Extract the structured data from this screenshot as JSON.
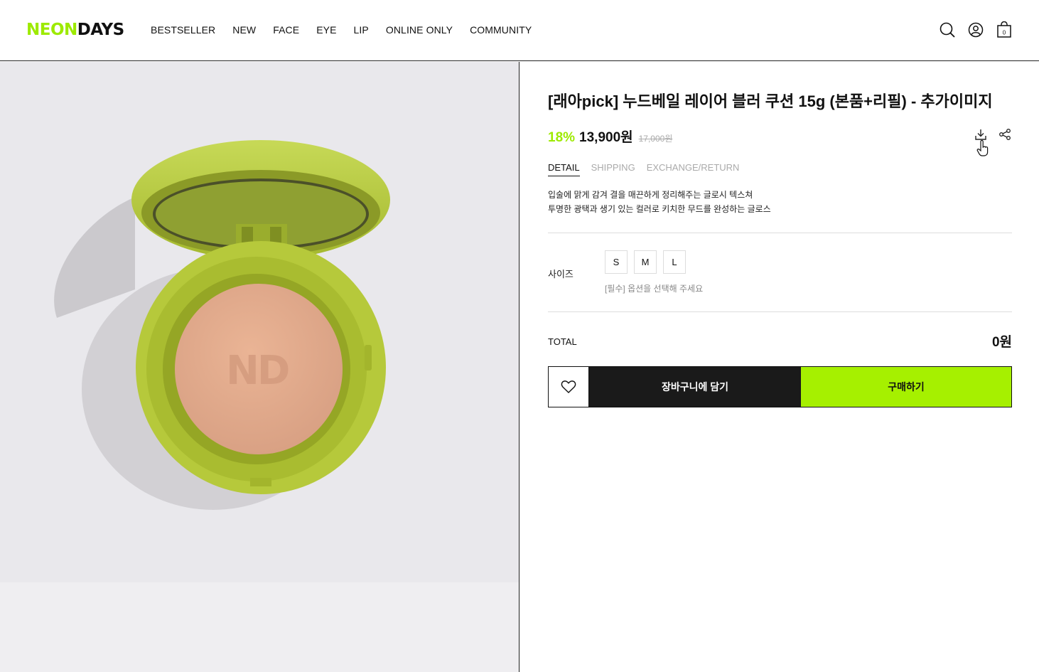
{
  "header": {
    "logo_neon": "NEON",
    "logo_days": "DAYS",
    "nav": [
      "BESTSELLER",
      "NEW",
      "FACE",
      "EYE",
      "LIP",
      "ONLINE ONLY",
      "COMMUNITY"
    ],
    "cart_count": "0",
    "icons": [
      "search-icon",
      "user-icon",
      "bag-icon"
    ]
  },
  "product": {
    "title": "[래아pick] 누드베일 레이어 블러 쿠션 15g (본품+리필) - 추가이미지",
    "discount": "18%",
    "price": "13,900원",
    "original_price": "17,000원",
    "image_emboss": "ND",
    "action_icons": [
      "download-icon",
      "share-icon"
    ]
  },
  "tabs": [
    "DETAIL",
    "SHIPPING",
    "EXCHANGE/RETURN"
  ],
  "description": [
    "입술에 맑게 감겨 결을 매끈하게 정리해주는 글로시 텍스쳐",
    "투명한 광택과 생기 있는 컬러로 키치한 무드를 완성하는 글로스"
  ],
  "option": {
    "label": "사이즈",
    "sizes": [
      "S",
      "M",
      "L"
    ],
    "help": "[필수] 옵션을 선택해 주세요"
  },
  "total": {
    "label": "TOTAL",
    "value": "0원"
  },
  "buttons": {
    "cart": "장바구니에 담기",
    "buy": "구매하기"
  },
  "colors": {
    "accent": "#a6f000",
    "dark": "#1a1a1a",
    "compact": "#b5c93a"
  }
}
